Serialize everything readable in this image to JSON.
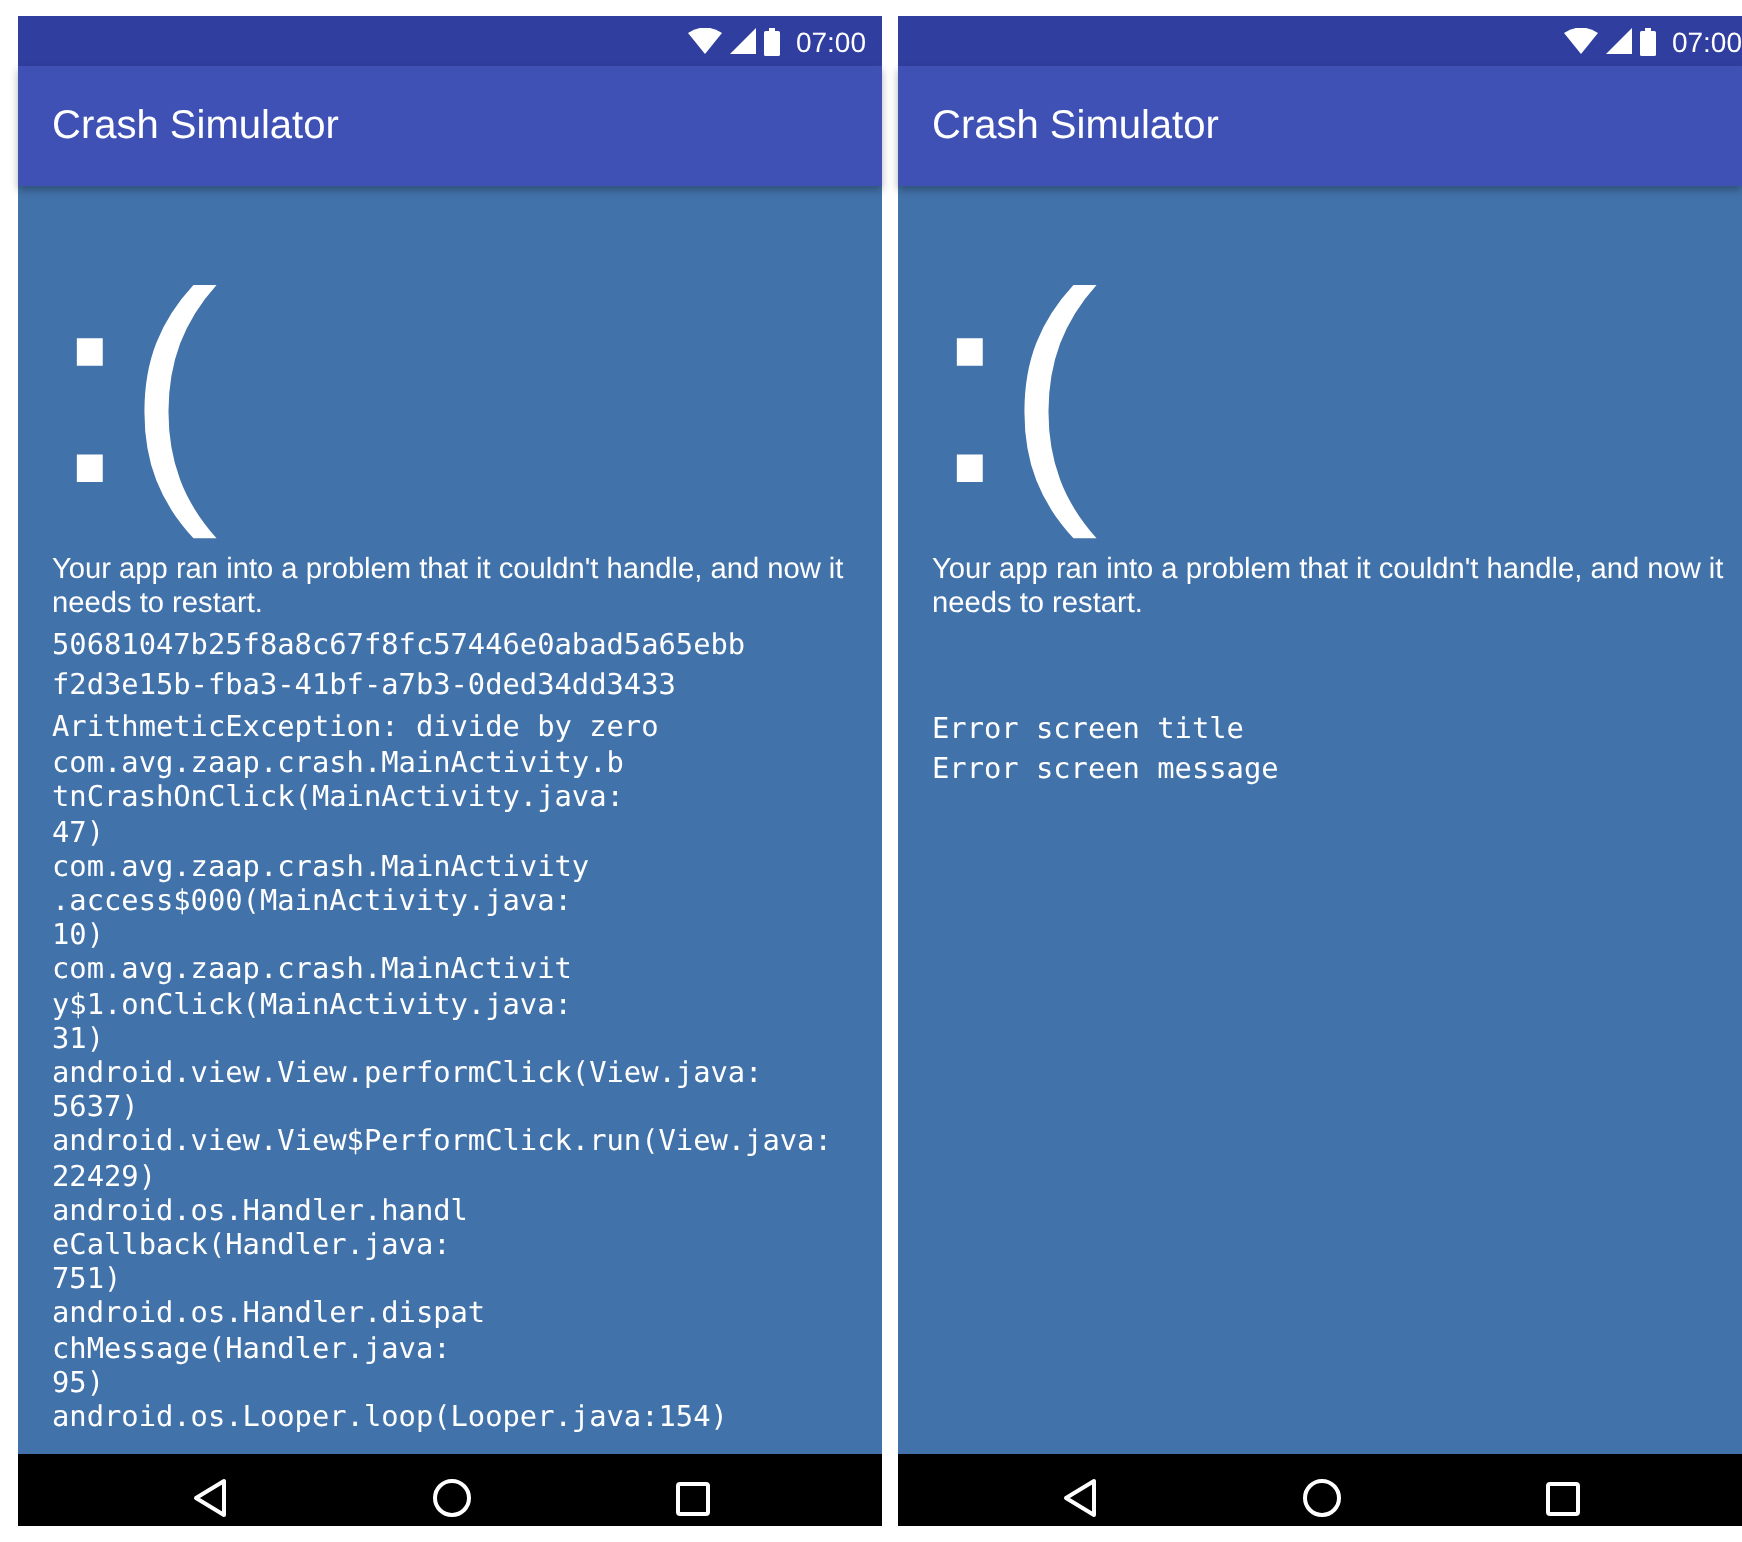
{
  "screens": [
    {
      "kind": "stacktrace",
      "status_bar": {
        "time": "07:00"
      },
      "app_bar": {
        "title": "Crash Simulator"
      },
      "face": ":(",
      "message": "Your app ran into a problem that it couldn't handle, and now it needs to restart.",
      "details": [
        "50681047b25f8a8c67f8fc57446e0abad5a65ebb",
        "f2d3e15b-fba3-41bf-a7b3-0ded34dd3433",
        "ArithmeticException: divide by zero"
      ],
      "trace": [
        {
          "lines": [
            "com.avg.zaap.crash.MainActivity.b",
            "tnCrashOnClick(MainActivity.java:",
            "47)"
          ]
        },
        {
          "lines": [
            "com.avg.zaap.crash.MainActivity",
            ".access$000(MainActivity.java:",
            "10)"
          ]
        },
        {
          "lines": [
            "com.avg.zaap.crash.MainActivit",
            "y$1.onClick(MainActivity.java:",
            "31)"
          ]
        },
        {
          "lines": [
            "android.view.View.performClick(View.java:",
            "5637)"
          ]
        },
        {
          "lines": [
            "android.view.View$PerformClick.run(View.java:",
            "22429)"
          ]
        },
        {
          "lines": [
            "android.os.Handler.handl",
            "eCallback(Handler.java:",
            "751)"
          ]
        },
        {
          "lines": [
            "android.os.Handler.dispat",
            "chMessage(Handler.java:",
            "95)"
          ]
        },
        {
          "lines": [
            "android.os.Looper.loop(Looper.java:154)"
          ]
        }
      ]
    },
    {
      "kind": "custom",
      "status_bar": {
        "time": "07:00"
      },
      "app_bar": {
        "title": "Crash Simulator"
      },
      "face": ":(",
      "message": "Your app ran into a problem that it couldn't handle, and now it needs to restart.",
      "details": [
        "Error screen title",
        "Error screen message"
      ]
    }
  ]
}
